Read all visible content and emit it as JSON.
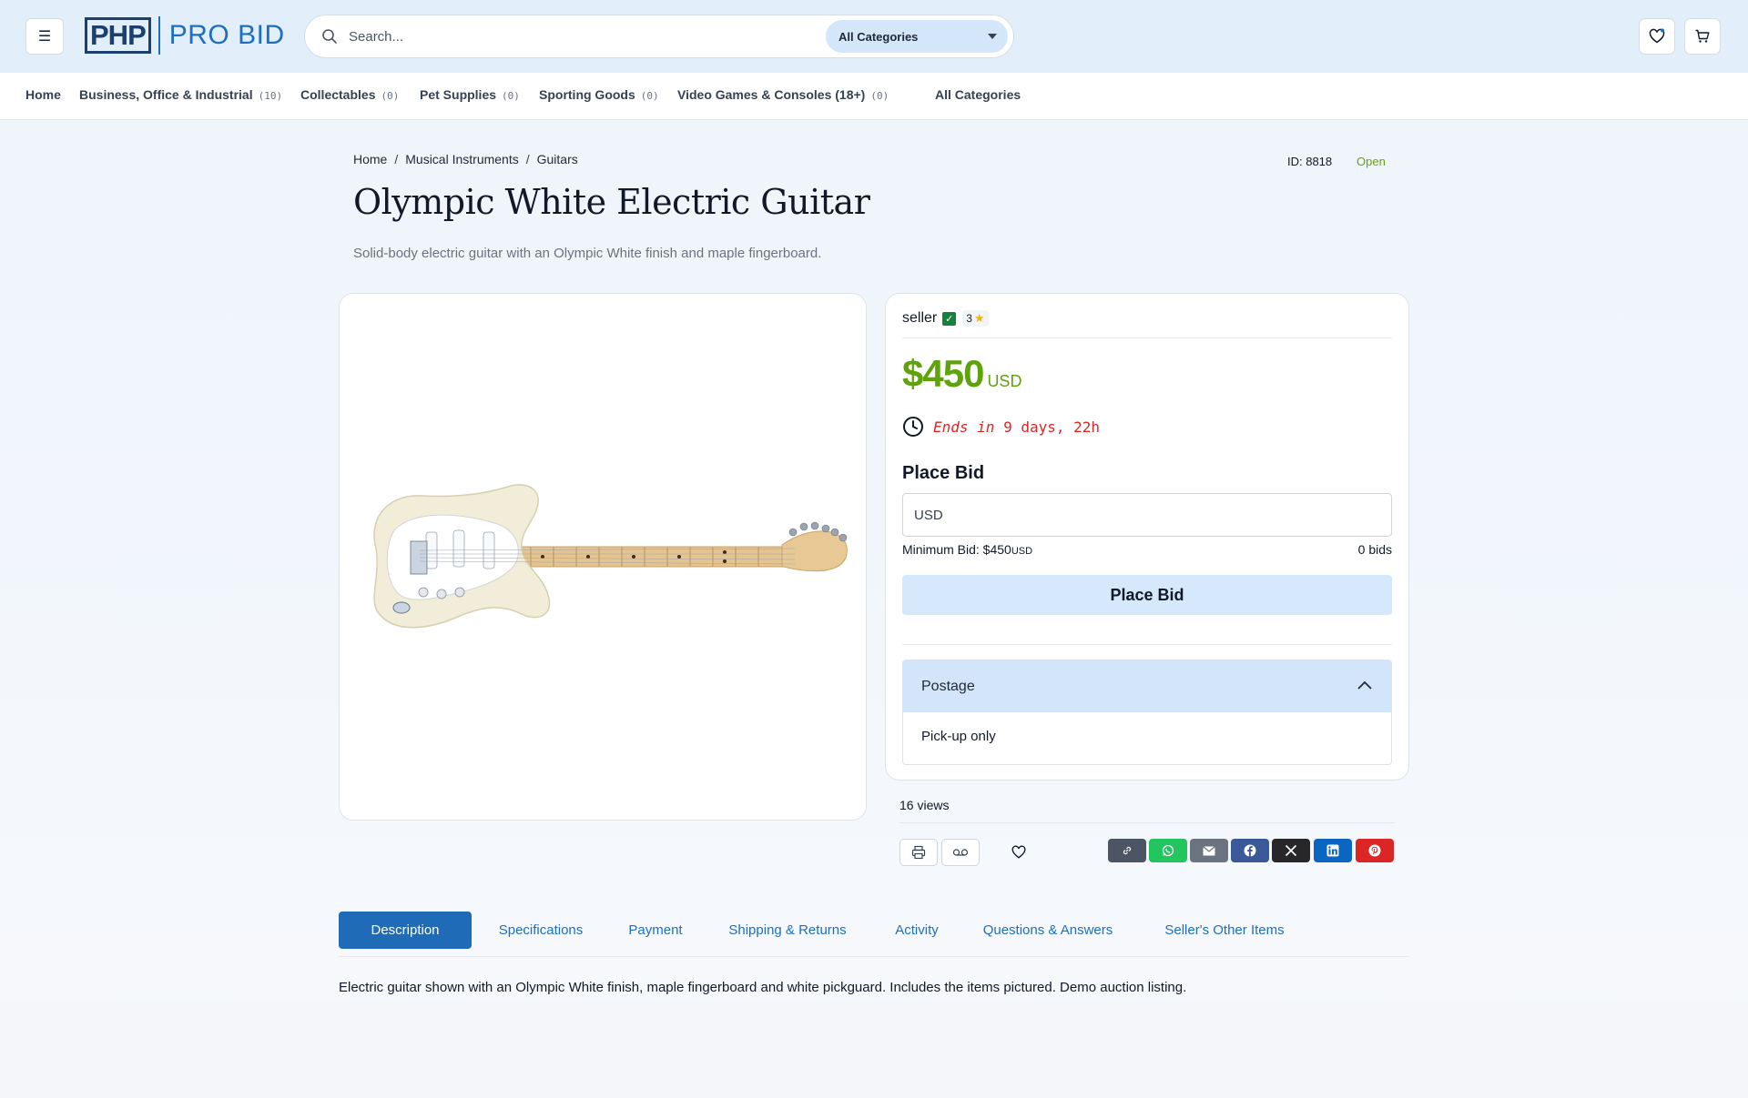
{
  "header": {
    "menu_icon": "hamburger-icon",
    "logo_php": "PHP",
    "logo_probid": "PRO BID",
    "search_placeholder": "Search...",
    "category_select": "All Categories",
    "wishlist_icon": "heart-icon",
    "cart_icon": "cart-icon"
  },
  "nav": {
    "home": "Home",
    "items": [
      {
        "label": "Business, Office & Industrial",
        "count": "(10)"
      },
      {
        "label": "Collectables",
        "count": "(0)"
      },
      {
        "label": "Pet Supplies",
        "count": "(0)"
      },
      {
        "label": "Sporting Goods",
        "count": "(0)"
      },
      {
        "label": "Video Games & Consoles (18+)",
        "count": "(0)"
      }
    ],
    "all_categories": "All Categories"
  },
  "breadcrumb": [
    "Home",
    "Musical Instruments",
    "Guitars"
  ],
  "listing": {
    "id_label": "ID: 8818",
    "status": "Open",
    "title": "Olympic White Electric Guitar",
    "subtitle": "Solid-body electric guitar with an Olympic White finish and maple fingerboard."
  },
  "bid_card": {
    "seller": "seller",
    "rating": "3",
    "price": "$450",
    "currency": "USD",
    "ends_label": "Ends in",
    "ends_value": "9 days, 22h",
    "place_bid_heading": "Place Bid",
    "bid_placeholder": "USD",
    "min_bid_label": "Minimum Bid: $450",
    "min_bid_currency": "USD",
    "bids_count": "0 bids",
    "place_bid_button": "Place Bid",
    "postage_title": "Postage",
    "postage_value": "Pick-up only"
  },
  "views": "16 views",
  "share_colors": {
    "link": "#4b5563",
    "whatsapp": "#22c55e",
    "email": "#6b7280",
    "facebook": "#3b5998",
    "x": "#27272a",
    "linkedin": "#0a66c2",
    "pinterest": "#dc2626"
  },
  "tabs": [
    "Description",
    "Specifications",
    "Payment",
    "Shipping & Returns",
    "Activity",
    "Questions & Answers",
    "Seller's Other Items"
  ],
  "active_tab": "Description",
  "description": "Electric guitar shown with an Olympic White finish, maple fingerboard and white pickguard. Includes the items pictured. Demo auction listing."
}
